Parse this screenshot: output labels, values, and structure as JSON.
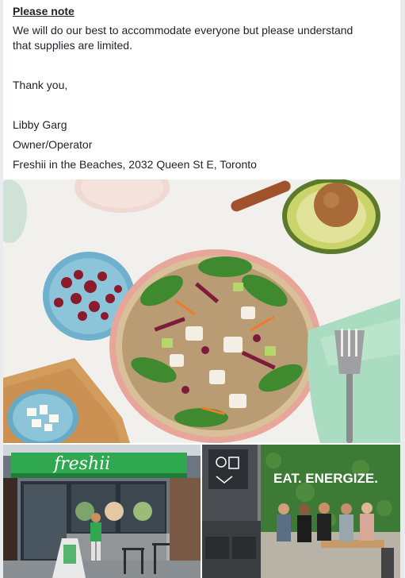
{
  "post": {
    "note_title": "Please note",
    "line1": "We will do our best to accommodate everyone but please understand",
    "line2": "that supplies are limited.",
    "thanks": "Thank you,",
    "name": "Libby Garg",
    "role": "Owner/Operator",
    "location": "Freshii in the Beaches, 2032 Queen St E, Toronto"
  },
  "photos": {
    "storefront_sign": "freshii",
    "wall_text": "EAT. ENERGIZE."
  },
  "colors": {
    "freshii_green": "#2fa84f",
    "wall_green": "#3d7a35",
    "bowl_pink": "#e8a59a"
  }
}
